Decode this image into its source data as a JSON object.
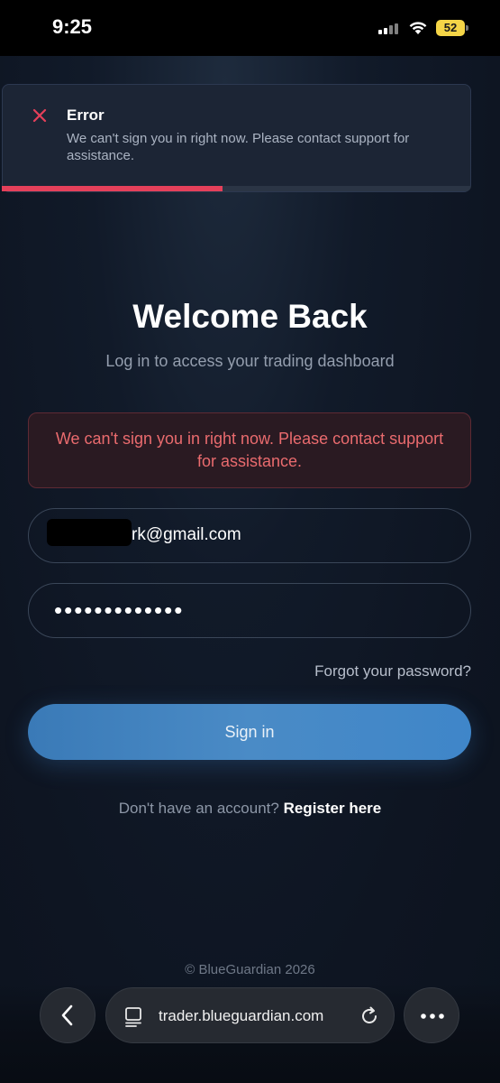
{
  "status_bar": {
    "time": "9:25",
    "battery": "52"
  },
  "toast": {
    "title": "Error",
    "message": "We can't sign you in right now. Please contact support for assistance.",
    "progress": 0.47,
    "accent_color": "#e5405a"
  },
  "login": {
    "heading": "Welcome Back",
    "subheading": "Log in to access your trading dashboard",
    "error_message": "We can't sign you in right now. Please contact support for assistance.",
    "email_visible": "rk@gmail.com",
    "password_masked": "•••••••••••••",
    "forgot_label": "Forgot your password?",
    "sign_in_label": "Sign in",
    "register_prompt": "Don't have an account?",
    "register_link": "Register here",
    "copyright": "© BlueGuardian 2026"
  },
  "browser": {
    "url": "trader.blueguardian.com",
    "icons": [
      "back-icon",
      "tabs-icon",
      "reload-icon",
      "more-icon"
    ]
  }
}
